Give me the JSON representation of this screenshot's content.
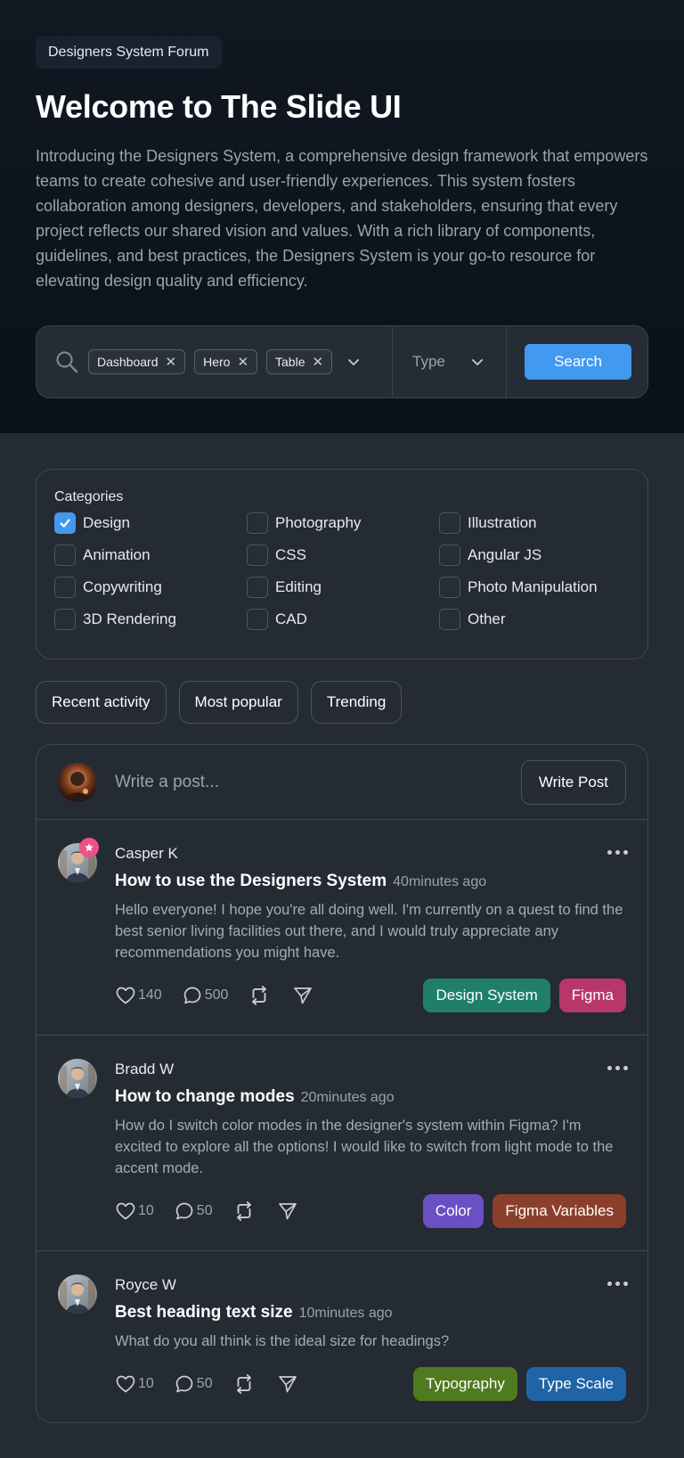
{
  "hero": {
    "badge": "Designers System Forum",
    "title": "Welcome to The Slide UI",
    "description": "Introducing the Designers System, a comprehensive design framework that empowers teams to create cohesive and user-friendly experiences. This system fosters collaboration among designers, developers, and stakeholders, ensuring that every project reflects our shared vision and values. With a rich library of components, guidelines, and best practices, the Designers System is your go-to resource for elevating design quality and efficiency."
  },
  "search": {
    "chips": [
      "Dashboard",
      "Hero",
      "Table"
    ],
    "type_placeholder": "Type",
    "button": "Search"
  },
  "categories": {
    "title": "Categories",
    "items": [
      {
        "label": "Design",
        "checked": true
      },
      {
        "label": "Photography",
        "checked": false
      },
      {
        "label": "Illustration",
        "checked": false
      },
      {
        "label": "Animation",
        "checked": false
      },
      {
        "label": "CSS",
        "checked": false
      },
      {
        "label": "Angular JS",
        "checked": false
      },
      {
        "label": "Copywriting",
        "checked": false
      },
      {
        "label": "Editing",
        "checked": false
      },
      {
        "label": "Photo Manipulation",
        "checked": false
      },
      {
        "label": "3D Rendering",
        "checked": false
      },
      {
        "label": "CAD",
        "checked": false
      },
      {
        "label": "Other",
        "checked": false
      }
    ]
  },
  "filters": [
    "Recent activity",
    "Most popular",
    "Trending"
  ],
  "composer": {
    "placeholder": "Write a post...",
    "button": "Write Post"
  },
  "posts": [
    {
      "author": "Casper K",
      "title": "How to use the Designers System",
      "time": "40minutes ago",
      "text": "Hello everyone! I hope you're all doing well. I'm currently on a quest to find the best senior living facilities out there, and I would truly appreciate any recommendations you might have.",
      "likes": "140",
      "comments": "500",
      "tags": [
        {
          "label": "Design System",
          "color": "#1f7f6b"
        },
        {
          "label": "Figma",
          "color": "#b8376a"
        }
      ]
    },
    {
      "author": "Bradd W",
      "title": "How to change modes",
      "time": "20minutes ago",
      "text": "How do I switch color modes in the designer's system within Figma? I'm excited to explore all the options! I would like to switch from light mode to the accent mode.",
      "likes": "10",
      "comments": "50",
      "tags": [
        {
          "label": "Color",
          "color": "#6b4fc4"
        },
        {
          "label": "Figma Variables",
          "color": "#8a3f2c"
        }
      ]
    },
    {
      "author": "Royce W",
      "title": "Best heading text size",
      "time": "10minutes ago",
      "text": "What do you all think is the ideal size for headings?",
      "likes": "10",
      "comments": "50",
      "tags": [
        {
          "label": "Typography",
          "color": "#4f7a1e"
        },
        {
          "label": "Type Scale",
          "color": "#1f64a6"
        }
      ]
    }
  ]
}
